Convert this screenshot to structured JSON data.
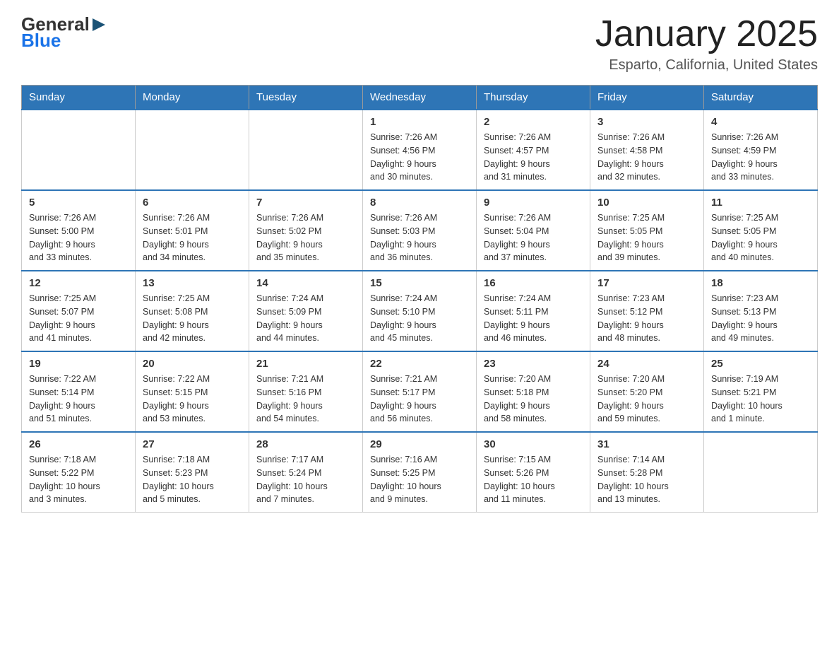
{
  "header": {
    "logo_line1": "General",
    "logo_line2": "Blue",
    "title": "January 2025",
    "subtitle": "Esparto, California, United States"
  },
  "weekdays": [
    "Sunday",
    "Monday",
    "Tuesday",
    "Wednesday",
    "Thursday",
    "Friday",
    "Saturday"
  ],
  "weeks": [
    [
      {
        "day": "",
        "info": ""
      },
      {
        "day": "",
        "info": ""
      },
      {
        "day": "",
        "info": ""
      },
      {
        "day": "1",
        "info": "Sunrise: 7:26 AM\nSunset: 4:56 PM\nDaylight: 9 hours\nand 30 minutes."
      },
      {
        "day": "2",
        "info": "Sunrise: 7:26 AM\nSunset: 4:57 PM\nDaylight: 9 hours\nand 31 minutes."
      },
      {
        "day": "3",
        "info": "Sunrise: 7:26 AM\nSunset: 4:58 PM\nDaylight: 9 hours\nand 32 minutes."
      },
      {
        "day": "4",
        "info": "Sunrise: 7:26 AM\nSunset: 4:59 PM\nDaylight: 9 hours\nand 33 minutes."
      }
    ],
    [
      {
        "day": "5",
        "info": "Sunrise: 7:26 AM\nSunset: 5:00 PM\nDaylight: 9 hours\nand 33 minutes."
      },
      {
        "day": "6",
        "info": "Sunrise: 7:26 AM\nSunset: 5:01 PM\nDaylight: 9 hours\nand 34 minutes."
      },
      {
        "day": "7",
        "info": "Sunrise: 7:26 AM\nSunset: 5:02 PM\nDaylight: 9 hours\nand 35 minutes."
      },
      {
        "day": "8",
        "info": "Sunrise: 7:26 AM\nSunset: 5:03 PM\nDaylight: 9 hours\nand 36 minutes."
      },
      {
        "day": "9",
        "info": "Sunrise: 7:26 AM\nSunset: 5:04 PM\nDaylight: 9 hours\nand 37 minutes."
      },
      {
        "day": "10",
        "info": "Sunrise: 7:25 AM\nSunset: 5:05 PM\nDaylight: 9 hours\nand 39 minutes."
      },
      {
        "day": "11",
        "info": "Sunrise: 7:25 AM\nSunset: 5:05 PM\nDaylight: 9 hours\nand 40 minutes."
      }
    ],
    [
      {
        "day": "12",
        "info": "Sunrise: 7:25 AM\nSunset: 5:07 PM\nDaylight: 9 hours\nand 41 minutes."
      },
      {
        "day": "13",
        "info": "Sunrise: 7:25 AM\nSunset: 5:08 PM\nDaylight: 9 hours\nand 42 minutes."
      },
      {
        "day": "14",
        "info": "Sunrise: 7:24 AM\nSunset: 5:09 PM\nDaylight: 9 hours\nand 44 minutes."
      },
      {
        "day": "15",
        "info": "Sunrise: 7:24 AM\nSunset: 5:10 PM\nDaylight: 9 hours\nand 45 minutes."
      },
      {
        "day": "16",
        "info": "Sunrise: 7:24 AM\nSunset: 5:11 PM\nDaylight: 9 hours\nand 46 minutes."
      },
      {
        "day": "17",
        "info": "Sunrise: 7:23 AM\nSunset: 5:12 PM\nDaylight: 9 hours\nand 48 minutes."
      },
      {
        "day": "18",
        "info": "Sunrise: 7:23 AM\nSunset: 5:13 PM\nDaylight: 9 hours\nand 49 minutes."
      }
    ],
    [
      {
        "day": "19",
        "info": "Sunrise: 7:22 AM\nSunset: 5:14 PM\nDaylight: 9 hours\nand 51 minutes."
      },
      {
        "day": "20",
        "info": "Sunrise: 7:22 AM\nSunset: 5:15 PM\nDaylight: 9 hours\nand 53 minutes."
      },
      {
        "day": "21",
        "info": "Sunrise: 7:21 AM\nSunset: 5:16 PM\nDaylight: 9 hours\nand 54 minutes."
      },
      {
        "day": "22",
        "info": "Sunrise: 7:21 AM\nSunset: 5:17 PM\nDaylight: 9 hours\nand 56 minutes."
      },
      {
        "day": "23",
        "info": "Sunrise: 7:20 AM\nSunset: 5:18 PM\nDaylight: 9 hours\nand 58 minutes."
      },
      {
        "day": "24",
        "info": "Sunrise: 7:20 AM\nSunset: 5:20 PM\nDaylight: 9 hours\nand 59 minutes."
      },
      {
        "day": "25",
        "info": "Sunrise: 7:19 AM\nSunset: 5:21 PM\nDaylight: 10 hours\nand 1 minute."
      }
    ],
    [
      {
        "day": "26",
        "info": "Sunrise: 7:18 AM\nSunset: 5:22 PM\nDaylight: 10 hours\nand 3 minutes."
      },
      {
        "day": "27",
        "info": "Sunrise: 7:18 AM\nSunset: 5:23 PM\nDaylight: 10 hours\nand 5 minutes."
      },
      {
        "day": "28",
        "info": "Sunrise: 7:17 AM\nSunset: 5:24 PM\nDaylight: 10 hours\nand 7 minutes."
      },
      {
        "day": "29",
        "info": "Sunrise: 7:16 AM\nSunset: 5:25 PM\nDaylight: 10 hours\nand 9 minutes."
      },
      {
        "day": "30",
        "info": "Sunrise: 7:15 AM\nSunset: 5:26 PM\nDaylight: 10 hours\nand 11 minutes."
      },
      {
        "day": "31",
        "info": "Sunrise: 7:14 AM\nSunset: 5:28 PM\nDaylight: 10 hours\nand 13 minutes."
      },
      {
        "day": "",
        "info": ""
      }
    ]
  ]
}
